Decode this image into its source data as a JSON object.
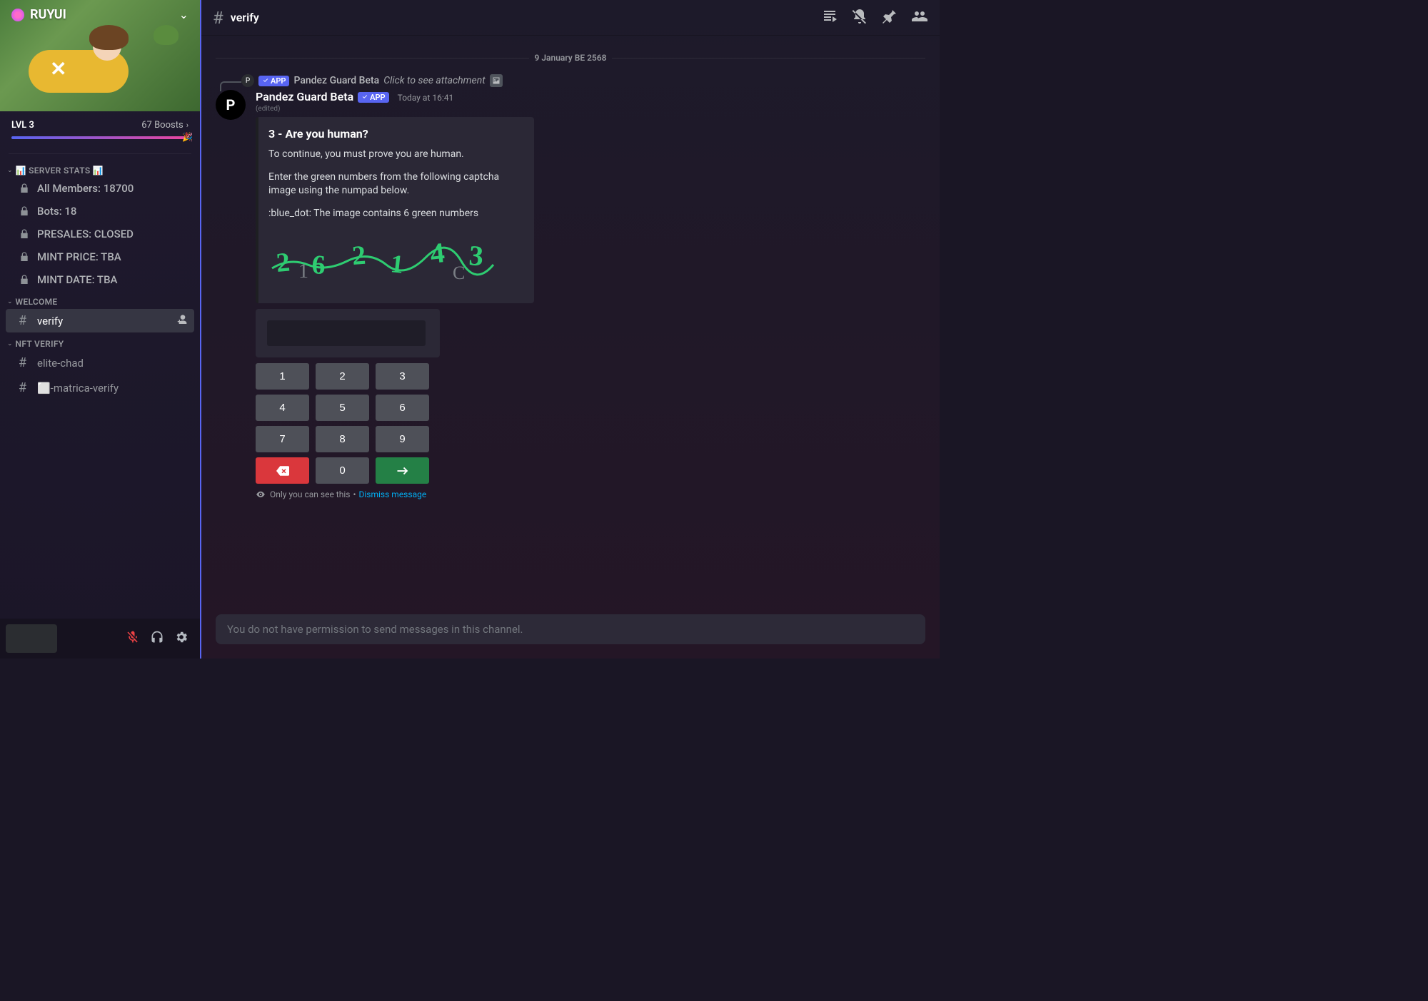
{
  "server": {
    "name": "RUYUI",
    "level": "LVL 3",
    "boosts_count": "67",
    "boosts_label": "Boosts"
  },
  "categories": {
    "server_stats": {
      "label": "📊 SERVER STATS 📊",
      "items": [
        "All Members: 18700",
        "Bots: 18",
        "PRESALES: CLOSED",
        "MINT PRICE: TBA",
        "MINT DATE: TBA"
      ]
    },
    "welcome": {
      "label": "WELCOME",
      "items": [
        "verify"
      ]
    },
    "nft_verify": {
      "label": "NFT VERIFY",
      "items": [
        "elite-chad",
        "⬜-matrica-verify"
      ]
    }
  },
  "header": {
    "channel_name": "verify"
  },
  "date_divider": "9 January BE 2568",
  "reply": {
    "author": "Pandez Guard Beta",
    "badge": "APP",
    "text": "Click to see attachment"
  },
  "message": {
    "author": "Pandez Guard Beta",
    "badge": "APP",
    "timestamp": "Today at 16:41",
    "edited": "(edited)"
  },
  "embed": {
    "title": "3 - Are you human?",
    "p1": "To continue, you must prove you are human.",
    "p2": "Enter the green numbers from the following captcha image using the numpad below.",
    "p3": ":blue_dot: The image contains 6 green numbers"
  },
  "captcha": {
    "green_digits": [
      "2",
      "6",
      "2",
      "1",
      "4",
      "3"
    ],
    "decoy_chars": [
      "1",
      "C"
    ],
    "green_color": "#2ecc71",
    "decoy_color": "#7a7f85"
  },
  "numpad": {
    "keys": [
      "1",
      "2",
      "3",
      "4",
      "5",
      "6",
      "7",
      "8",
      "9",
      "0"
    ]
  },
  "ephemeral": {
    "text": "Only you can see this",
    "dismiss": "Dismiss message"
  },
  "input": {
    "placeholder": "You do not have permission to send messages in this channel."
  }
}
